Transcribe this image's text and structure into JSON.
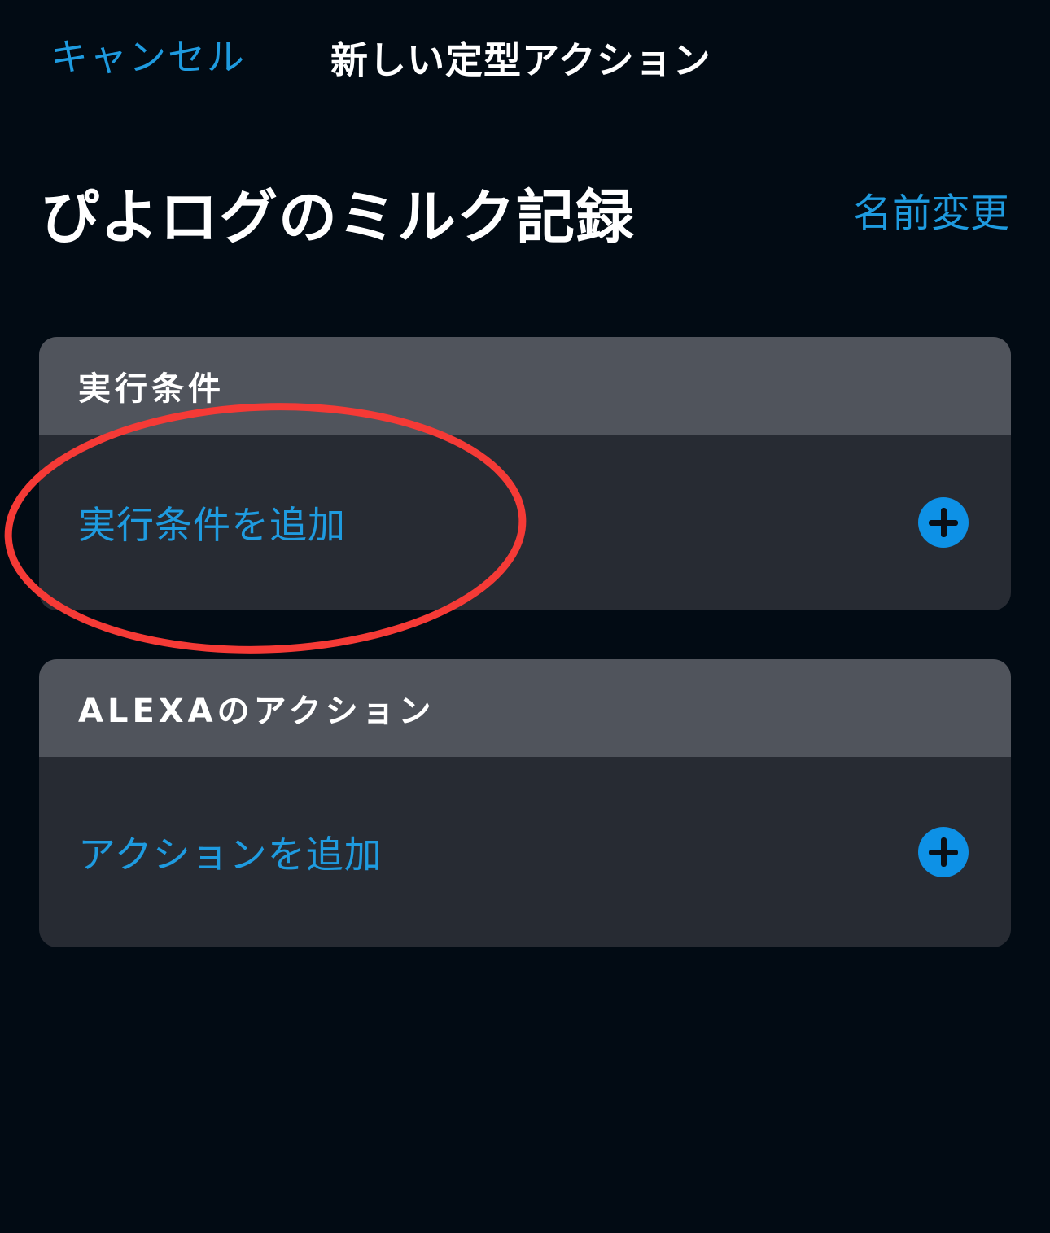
{
  "nav": {
    "cancel_label": "キャンセル",
    "title": "新しい定型アクション"
  },
  "routine": {
    "name": "ぴよログのミルク記録",
    "rename_label": "名前変更"
  },
  "sections": [
    {
      "header": "実行条件",
      "add_label": "実行条件を追加",
      "icon": "plus-circle-icon"
    },
    {
      "header": "ALEXAのアクション",
      "add_label": "アクションを追加",
      "icon": "plus-circle-icon"
    }
  ],
  "colors": {
    "background": "#020b14",
    "accent": "#1e9be0",
    "card_header": "#50545c",
    "card_body": "#272b33",
    "annotation": "#f53a36"
  }
}
